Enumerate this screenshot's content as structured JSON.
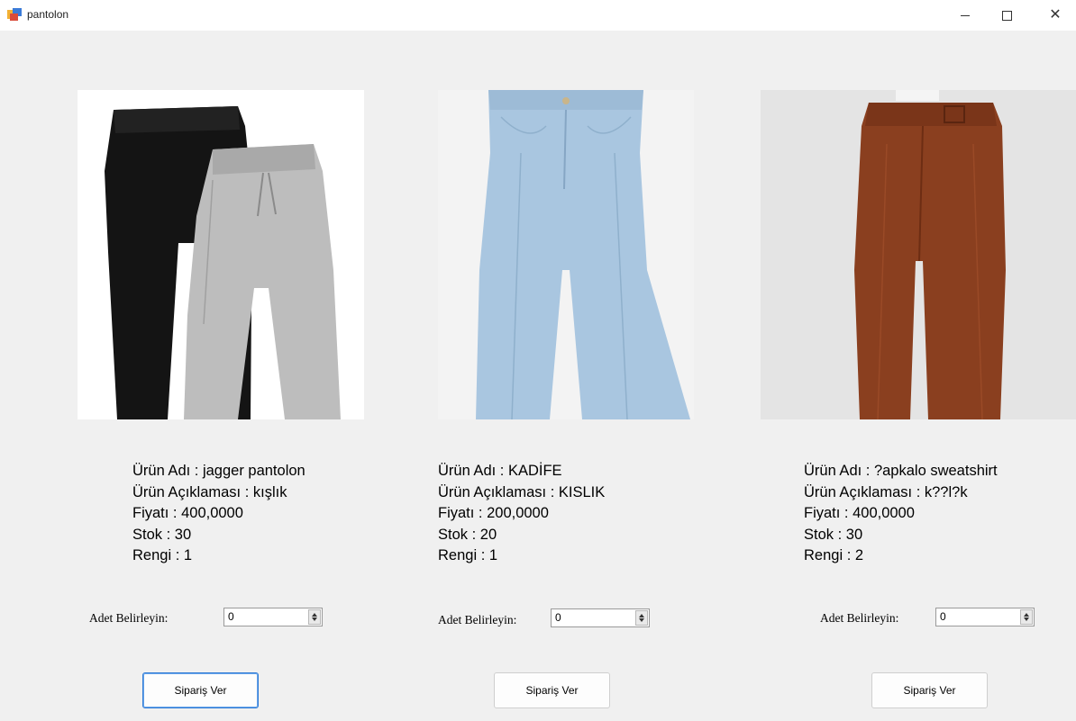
{
  "window": {
    "title": "pantolon",
    "controls": {
      "minimize": "minimize-icon",
      "maximize": "maximize-icon",
      "close": "close-icon"
    }
  },
  "products": [
    {
      "image": "black-and-grey-jogger-pants",
      "name": "Ürün Adı : jagger pantolon",
      "description": "Ürün Açıklaması : kışlık",
      "price": "Fiyatı : 400,0000",
      "stock": "Stok : 30",
      "color": "Rengi : 1",
      "qty_label": "Adet Belirleyin:",
      "qty_value": "0",
      "order_label": "Sipariş Ver"
    },
    {
      "image": "light-blue-wide-leg-jeans",
      "name": "Ürün Adı : KADİFE",
      "description": "Ürün Açıklaması : KISLIK",
      "price": "Fiyatı : 200,0000",
      "stock": "Stok : 20",
      "color": "Rengi : 1",
      "qty_label": "Adet Belirleyin:",
      "qty_value": "0",
      "order_label": "Sipariş Ver"
    },
    {
      "image": "brown-corduroy-trousers",
      "name": "Ürün Adı : ?apkalo sweatshirt",
      "description": "Ürün Açıklaması : k??l?k",
      "price": "Fiyatı : 400,0000",
      "stock": "Stok : 30",
      "color": "Rengi : 2",
      "qty_label": "Adet Belirleyin:",
      "qty_value": "0",
      "order_label": "Sipariş Ver"
    }
  ]
}
